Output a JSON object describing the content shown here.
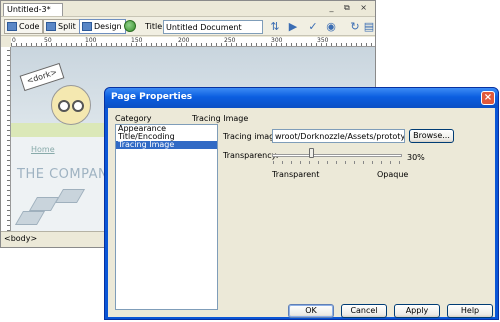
{
  "editor": {
    "tab_title": "Untitled-3*",
    "window_controls": "_ ⧉ ×",
    "toolbar": {
      "code_label": "Code",
      "split_label": "Split",
      "design_label": "Design",
      "title_label": "Title:",
      "title_value": "Untitled Document"
    },
    "ruler_ticks": [
      "0",
      "50",
      "100",
      "150",
      "200",
      "250",
      "300",
      "350"
    ],
    "canvas": {
      "sign_text": "<dork>",
      "home_link": "Home",
      "company_text": "THE COMPANY"
    },
    "status_tag": "<body>"
  },
  "dialog": {
    "title": "Page Properties",
    "close_glyph": "×",
    "category_label": "Category",
    "categories": [
      "Appearance",
      "Title/Encoding",
      "Tracing Image"
    ],
    "selected_category_index": 2,
    "section_title": "Tracing Image",
    "tracing_image_label": "Tracing image:",
    "tracing_image_value": "wroot/Dorknozzle/Assets/prototype.gif",
    "browse_label": "Browse...",
    "transparency_label": "Transparency:",
    "transparency_value_text": "30%",
    "transparency_fraction": 0.3,
    "slider_min_label": "Transparent",
    "slider_max_label": "Opaque",
    "buttons": {
      "ok": "OK",
      "cancel": "Cancel",
      "apply": "Apply",
      "help": "Help"
    }
  },
  "colors": {
    "titlebar_blue": "#0a56d6",
    "selection_blue": "#316ac5",
    "close_red": "#e0593c"
  }
}
